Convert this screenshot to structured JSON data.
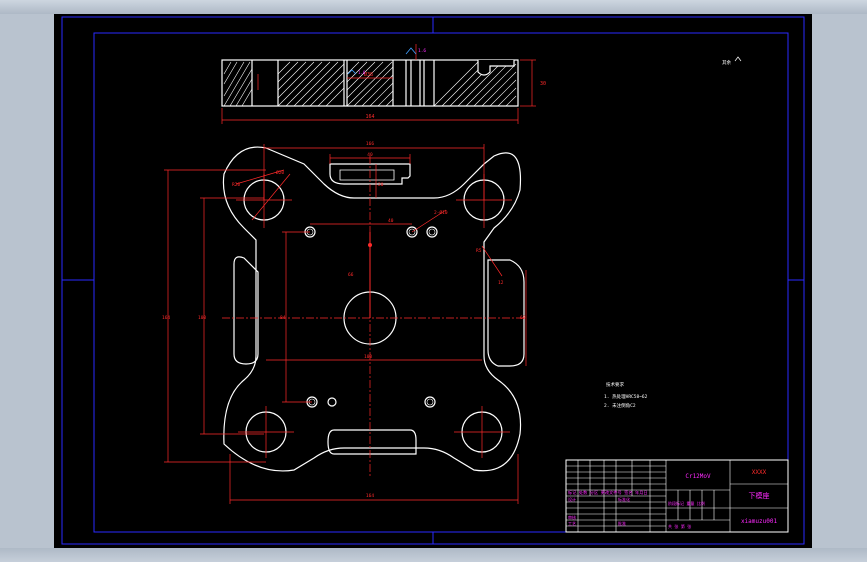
{
  "colors": {
    "background": "#000000",
    "frame": "#1a1aff",
    "outline": "#ffffff",
    "dimension": "#ff2a2a",
    "title_block": "#ffffff",
    "title_text": "#ff2aff"
  },
  "top_view": {
    "overall_width_dim": "164",
    "height_dim": "30",
    "hole_label": "Ø38",
    "section_mark": "1.6",
    "roughness_mark": "1.6"
  },
  "plan_view": {
    "dims": {
      "top_width": "166",
      "slot_width": "40",
      "slot_depth": "20",
      "corner_radius": "R20",
      "corner_hole": "Ø20",
      "left_height": "164",
      "inner_height": "100",
      "inner_small": "84",
      "hole_spacing": "40",
      "hole_small": "2-Ø10",
      "center_height": "66",
      "right_slot": "12",
      "right_radius": "R5",
      "right_height": "60",
      "bottom_inner": "100",
      "bottom_width": "164"
    }
  },
  "general_roughness": "其余",
  "notes": {
    "title": "技术要求",
    "line1": "1. 热处理HRC58~62",
    "line2": "2. 未注倒角C2"
  },
  "title_block": {
    "material": "Cr12MoV",
    "project_code": "XXXX",
    "part_name": "下模座",
    "drawing_number": "xiamuzu001",
    "row_header": "标记 处数 分区 更改文件号 签名 年月日",
    "design_label": "设计",
    "std_label": "标准化",
    "review_label": "审核",
    "process_label": "工艺",
    "approve_label": "批准",
    "stage_label": "阶段标记 重量 比例",
    "sheet_label": "共 张 第 张"
  }
}
